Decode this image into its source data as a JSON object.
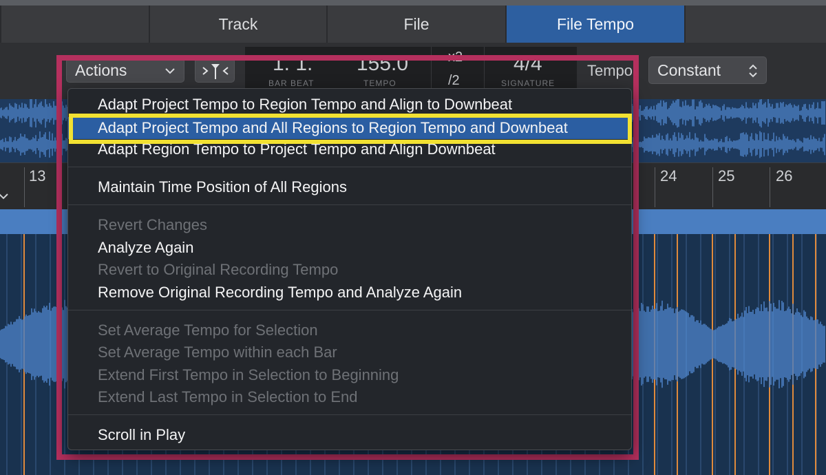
{
  "tabs": [
    {
      "label": "Track",
      "active": false
    },
    {
      "label": "File",
      "active": false
    },
    {
      "label": "File Tempo",
      "active": true
    }
  ],
  "toolbar": {
    "actions_label": "Actions",
    "lcd_position": "1. 1.",
    "lcd_position_caption": "BAR  BEAT",
    "lcd_tempo": "155.0",
    "lcd_tempo_caption": "TEMPO",
    "lcd_mult_top": "x2",
    "lcd_mult_bottom": "/2",
    "lcd_signature": "4/4",
    "lcd_signature_caption": "SIGNATURE",
    "tempo_label": "Tempo:",
    "tempo_mode": "Constant"
  },
  "ruler": {
    "bars": [
      "13",
      "24",
      "25",
      "26"
    ]
  },
  "menu": {
    "items": [
      {
        "label": "Adapt Project Tempo to Region Tempo and Align to Downbeat",
        "enabled": true
      },
      {
        "label": "Adapt Project Tempo and All Regions to Region Tempo and Downbeat",
        "enabled": true,
        "selected": true
      },
      {
        "label": "Adapt Region Tempo to Project Tempo and Align Downbeat",
        "enabled": true
      },
      {
        "label": "Maintain Time Position of All Regions",
        "enabled": true
      },
      {
        "label": "Revert Changes",
        "enabled": false
      },
      {
        "label": "Analyze Again",
        "enabled": true
      },
      {
        "label": "Revert to Original Recording Tempo",
        "enabled": false
      },
      {
        "label": "Remove Original Recording Tempo and Analyze Again",
        "enabled": true
      },
      {
        "label": "Set Average Tempo for Selection",
        "enabled": false
      },
      {
        "label": "Set Average Tempo within each Bar",
        "enabled": false
      },
      {
        "label": "Extend First Tempo in Selection to Beginning",
        "enabled": false
      },
      {
        "label": "Extend Last Tempo in Selection to End",
        "enabled": false
      },
      {
        "label": "Scroll in Play",
        "enabled": true
      }
    ]
  },
  "colors": {
    "accent": "#2b5ea2",
    "highlight_magenta": "#b5305e",
    "highlight_yellow": "#f2e132",
    "waveform": "#4a7ec1",
    "transient_marker": "#e08a3c"
  },
  "icons": [
    "chevron-down-icon",
    "snap-marker-icon",
    "stepper-updown-icon"
  ]
}
